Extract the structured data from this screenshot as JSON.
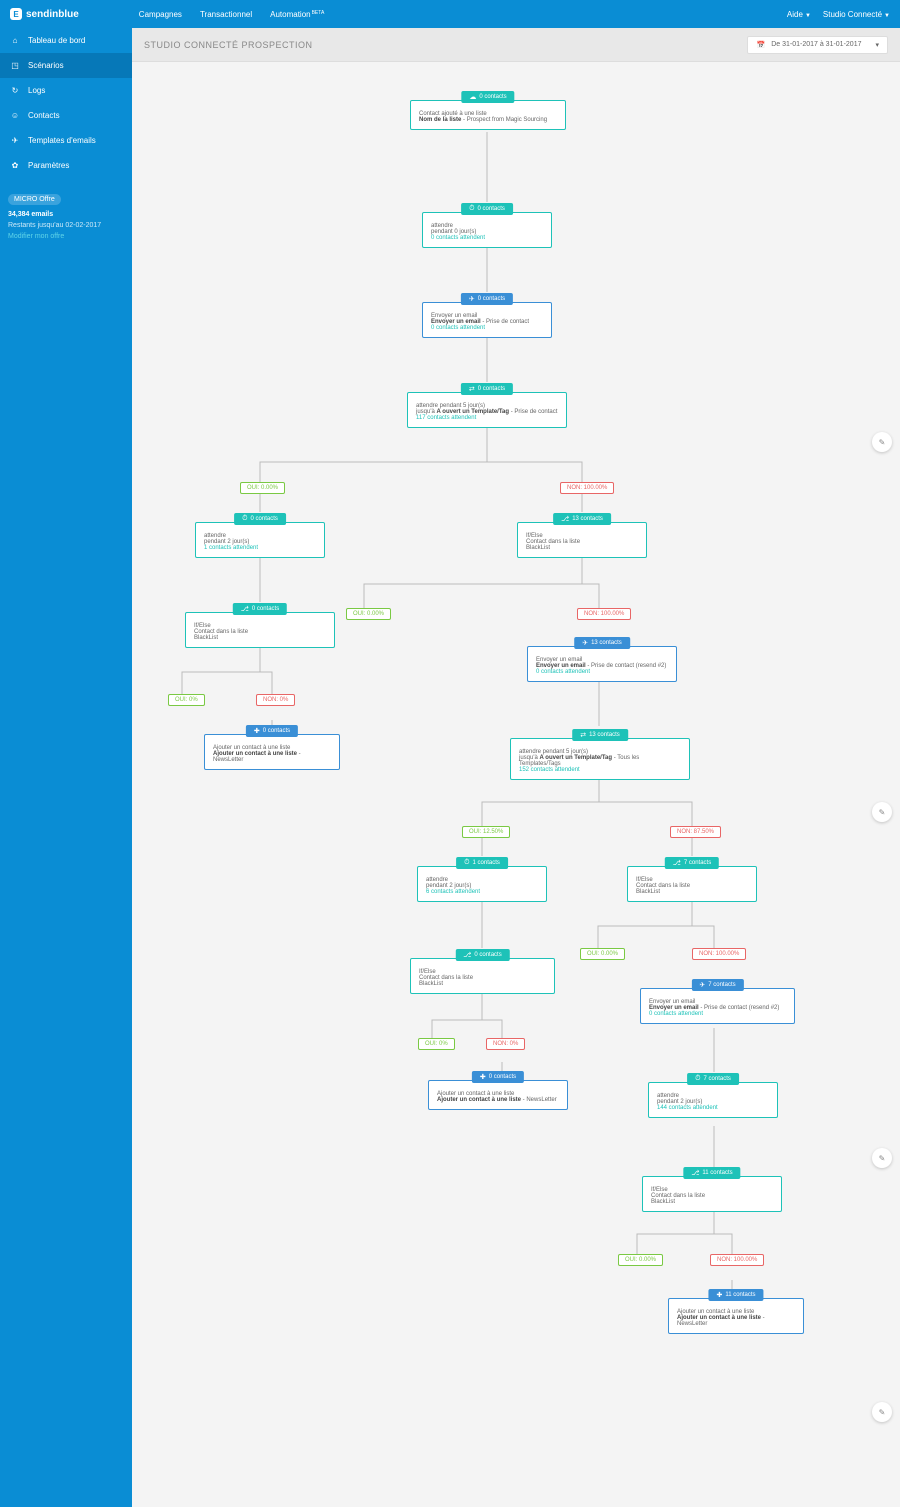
{
  "brand": "sendinblue",
  "topnav": {
    "campagnes": "Campagnes",
    "trans": "Transactionnel",
    "auto": "Automation",
    "beta": "BETA"
  },
  "topright": {
    "aide": "Aide",
    "account": "Studio Connecté"
  },
  "sidebar": {
    "dashboard": "Tableau de bord",
    "scenarios": "Scénarios",
    "logs": "Logs",
    "contacts": "Contacts",
    "templates": "Templates d'emails",
    "params": "Paramètres"
  },
  "plan": {
    "badge": "MICRO Offre",
    "emails": "34,384 emails",
    "until": "Restants jusqu'au 02-02-2017",
    "modify": "Modifier mon offre"
  },
  "header": {
    "title": "STUDIO CONNECTÉ PROSPECTION",
    "date": "De 31-01-2017 à 31-01-2017"
  },
  "labels": {
    "oui_0": "OUI: 0.00%",
    "non_100": "NON: 100.00%",
    "oui_pct0": "OUI: 0%",
    "non_pct0": "NON: 0%",
    "oui_1250": "OUI: 12.50%",
    "non_8750": "NON: 87.50%",
    "oui_000": "OUI: 0.00%",
    "non_10000": "NON: 100.00%"
  },
  "nodes": {
    "n1": {
      "pill": "0 contacts",
      "l1": "Contact ajouté à une liste",
      "l2a": "Nom de la liste",
      "l2b": " - Prospect from Magic Sourcing"
    },
    "n2": {
      "pill": "0 contacts",
      "l1": "attendre",
      "l2": "pendant 0 jour(s)",
      "l3": "0 contacts attendent"
    },
    "n3": {
      "pill": "0 contacts",
      "l1": "Envoyer un email",
      "l2a": "Envoyer un email",
      "l2b": " - Prise de contact",
      "l3": "0 contacts attendent"
    },
    "n4": {
      "pill": "0 contacts",
      "l1": "attendre pendant 5 jour(s)",
      "l2a": "jusqu'à ",
      "l2b": "A ouvert un Template/Tag",
      "l2c": " - Prise de contact",
      "l3": "117 contacts attendent"
    },
    "n5": {
      "pill": "0 contacts",
      "l1": "attendre",
      "l2": "pendant 2 jour(s)",
      "l3": "1 contacts attendent"
    },
    "n6": {
      "pill": "13 contacts",
      "l1": "If/Else",
      "l2": "Contact dans la liste",
      "l3": "BlackList"
    },
    "n7": {
      "pill": "0 contacts",
      "l1": "If/Else",
      "l2": "Contact dans la liste",
      "l3": "BlackList"
    },
    "n8": {
      "pill": "13 contacts",
      "l1": "Envoyer un email",
      "l2a": "Envoyer un email",
      "l2b": " - Prise de contact (resend #2)",
      "l3": "0 contacts attendent"
    },
    "n9": {
      "pill": "0 contacts",
      "l1": "Ajouter un contact à une liste",
      "l2a": "Ajouter un contact à une liste",
      "l2b": " - NewsLetter"
    },
    "n10": {
      "pill": "13 contacts",
      "l1": "attendre pendant 5 jour(s)",
      "l2a": "jusqu'à ",
      "l2b": "A ouvert un Template/Tag",
      "l2c": " - Tous les Templates/Tags",
      "l3": "152 contacts attendent"
    },
    "n11": {
      "pill": "1 contacts",
      "l1": "attendre",
      "l2": "pendant 2 jour(s)",
      "l3": "6 contacts attendent"
    },
    "n12": {
      "pill": "7 contacts",
      "l1": "If/Else",
      "l2": "Contact dans la liste",
      "l3": "BlackList"
    },
    "n13": {
      "pill": "0 contacts",
      "l1": "If/Else",
      "l2": "Contact dans la liste",
      "l3": "BlackList"
    },
    "n14": {
      "pill": "7 contacts",
      "l1": "Envoyer un email",
      "l2a": "Envoyer un email",
      "l2b": " - Prise de contact (resend #2)",
      "l3": "0 contacts attendent"
    },
    "n15": {
      "pill": "0 contacts",
      "l1": "Ajouter un contact à une liste",
      "l2a": "Ajouter un contact à une liste",
      "l2b": " - NewsLetter"
    },
    "n16": {
      "pill": "7 contacts",
      "l1": "attendre",
      "l2": "pendant 2 jour(s)",
      "l3": "144 contacts attendent"
    },
    "n17": {
      "pill": "11 contacts",
      "l1": "If/Else",
      "l2": "Contact dans la liste",
      "l3": "BlackList"
    },
    "n18": {
      "pill": "11 contacts",
      "l1": "Ajouter un contact à une liste",
      "l2a": "Ajouter un contact à une liste",
      "l2b": " - NewsLetter"
    }
  }
}
